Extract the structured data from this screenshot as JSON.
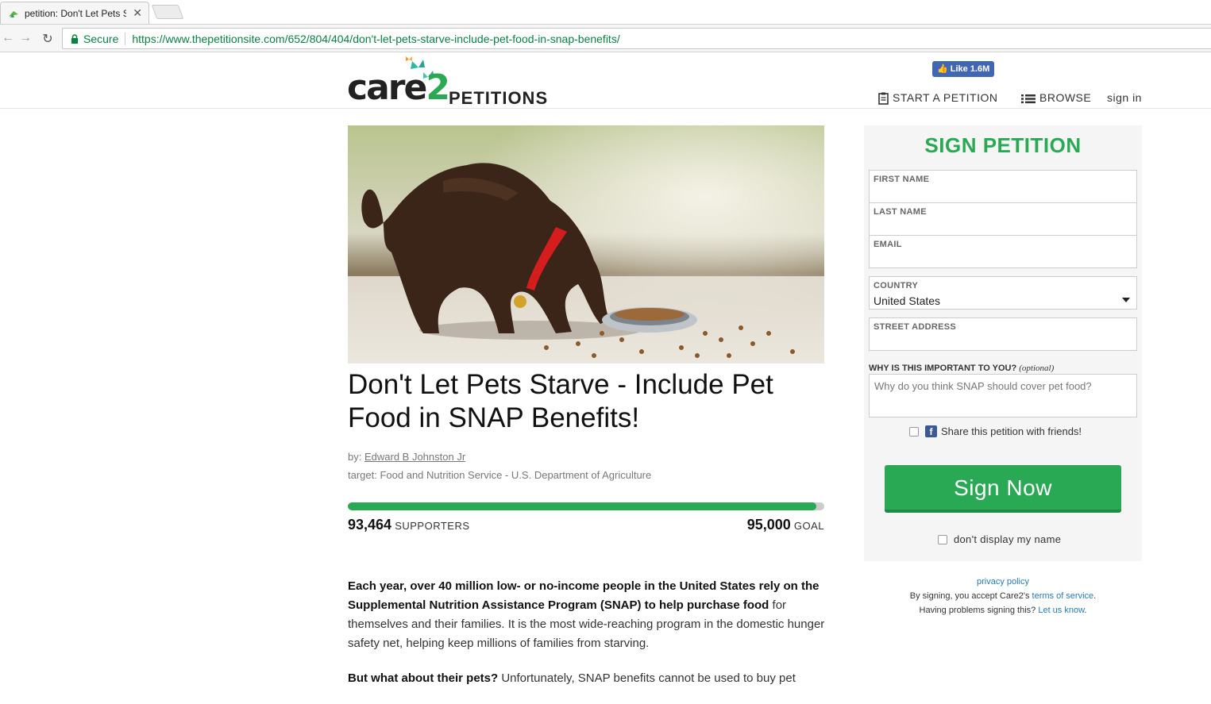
{
  "browser": {
    "tab_title": "petition: Don't Let Pets S",
    "address_secure_label": "Secure",
    "url_host": "https://www.thepetitionsite.com",
    "url_path": "/652/804/404/don't-let-pets-starve-include-pet-food-in-snap-benefits/"
  },
  "header": {
    "logo_main": "care",
    "logo_two": "2",
    "logo_sub": "PETITIONS",
    "fb_like": "Like 1.6M",
    "nav": {
      "start": "START A PETITION",
      "browse": "BROWSE",
      "signin": "sign in"
    }
  },
  "petition": {
    "title": "Don't Let Pets Starve - Include Pet Food in SNAP Benefits!",
    "by_label": "by:",
    "author": "Edward B Johnston Jr",
    "target": "target: Food and Nutrition Service - U.S. Department of Agriculture",
    "supporters_count": "93,464",
    "supporters_label": "SUPPORTERS",
    "goal_count": "95,000",
    "goal_label": "GOAL",
    "progress_fraction": 0.984,
    "body_bold_1": "Each year, over 40 million low- or no-income people in the United States rely on the Supplemental Nutrition Assistance Program (SNAP) to help purchase food",
    "body_rest_1": " for themselves and their families. It is the most wide-reaching program in the domestic hunger safety net, helping keep millions of families from starving.",
    "body_bold_2": "But what about their pets?",
    "body_rest_2": " Unfortunately, SNAP benefits cannot be used to buy pet"
  },
  "sign": {
    "heading": "SIGN PETITION",
    "first_name_label": "FIRST NAME",
    "last_name_label": "LAST NAME",
    "email_label": "EMAIL",
    "country_label": "COUNTRY",
    "country_value": "United States",
    "street_label": "STREET ADDRESS",
    "why_label": "WHY IS THIS IMPORTANT TO YOU?",
    "why_optional": "(optional)",
    "why_placeholder": "Why do you think SNAP should cover pet food?",
    "share_label": "Share this petition with friends!",
    "button": "Sign Now",
    "no_display": "don't display my name"
  },
  "legal": {
    "privacy": "privacy policy",
    "accept_prefix": "By signing, you accept Care2's ",
    "terms": "terms of service",
    "accept_suffix": ".",
    "problems_prefix": "Having problems signing this? ",
    "let_us_know": "Let us know",
    "problems_suffix": "."
  },
  "colors": {
    "brand_green": "#2aa955",
    "link_blue": "#2a7ab0",
    "facebook_blue": "#4267b2"
  }
}
